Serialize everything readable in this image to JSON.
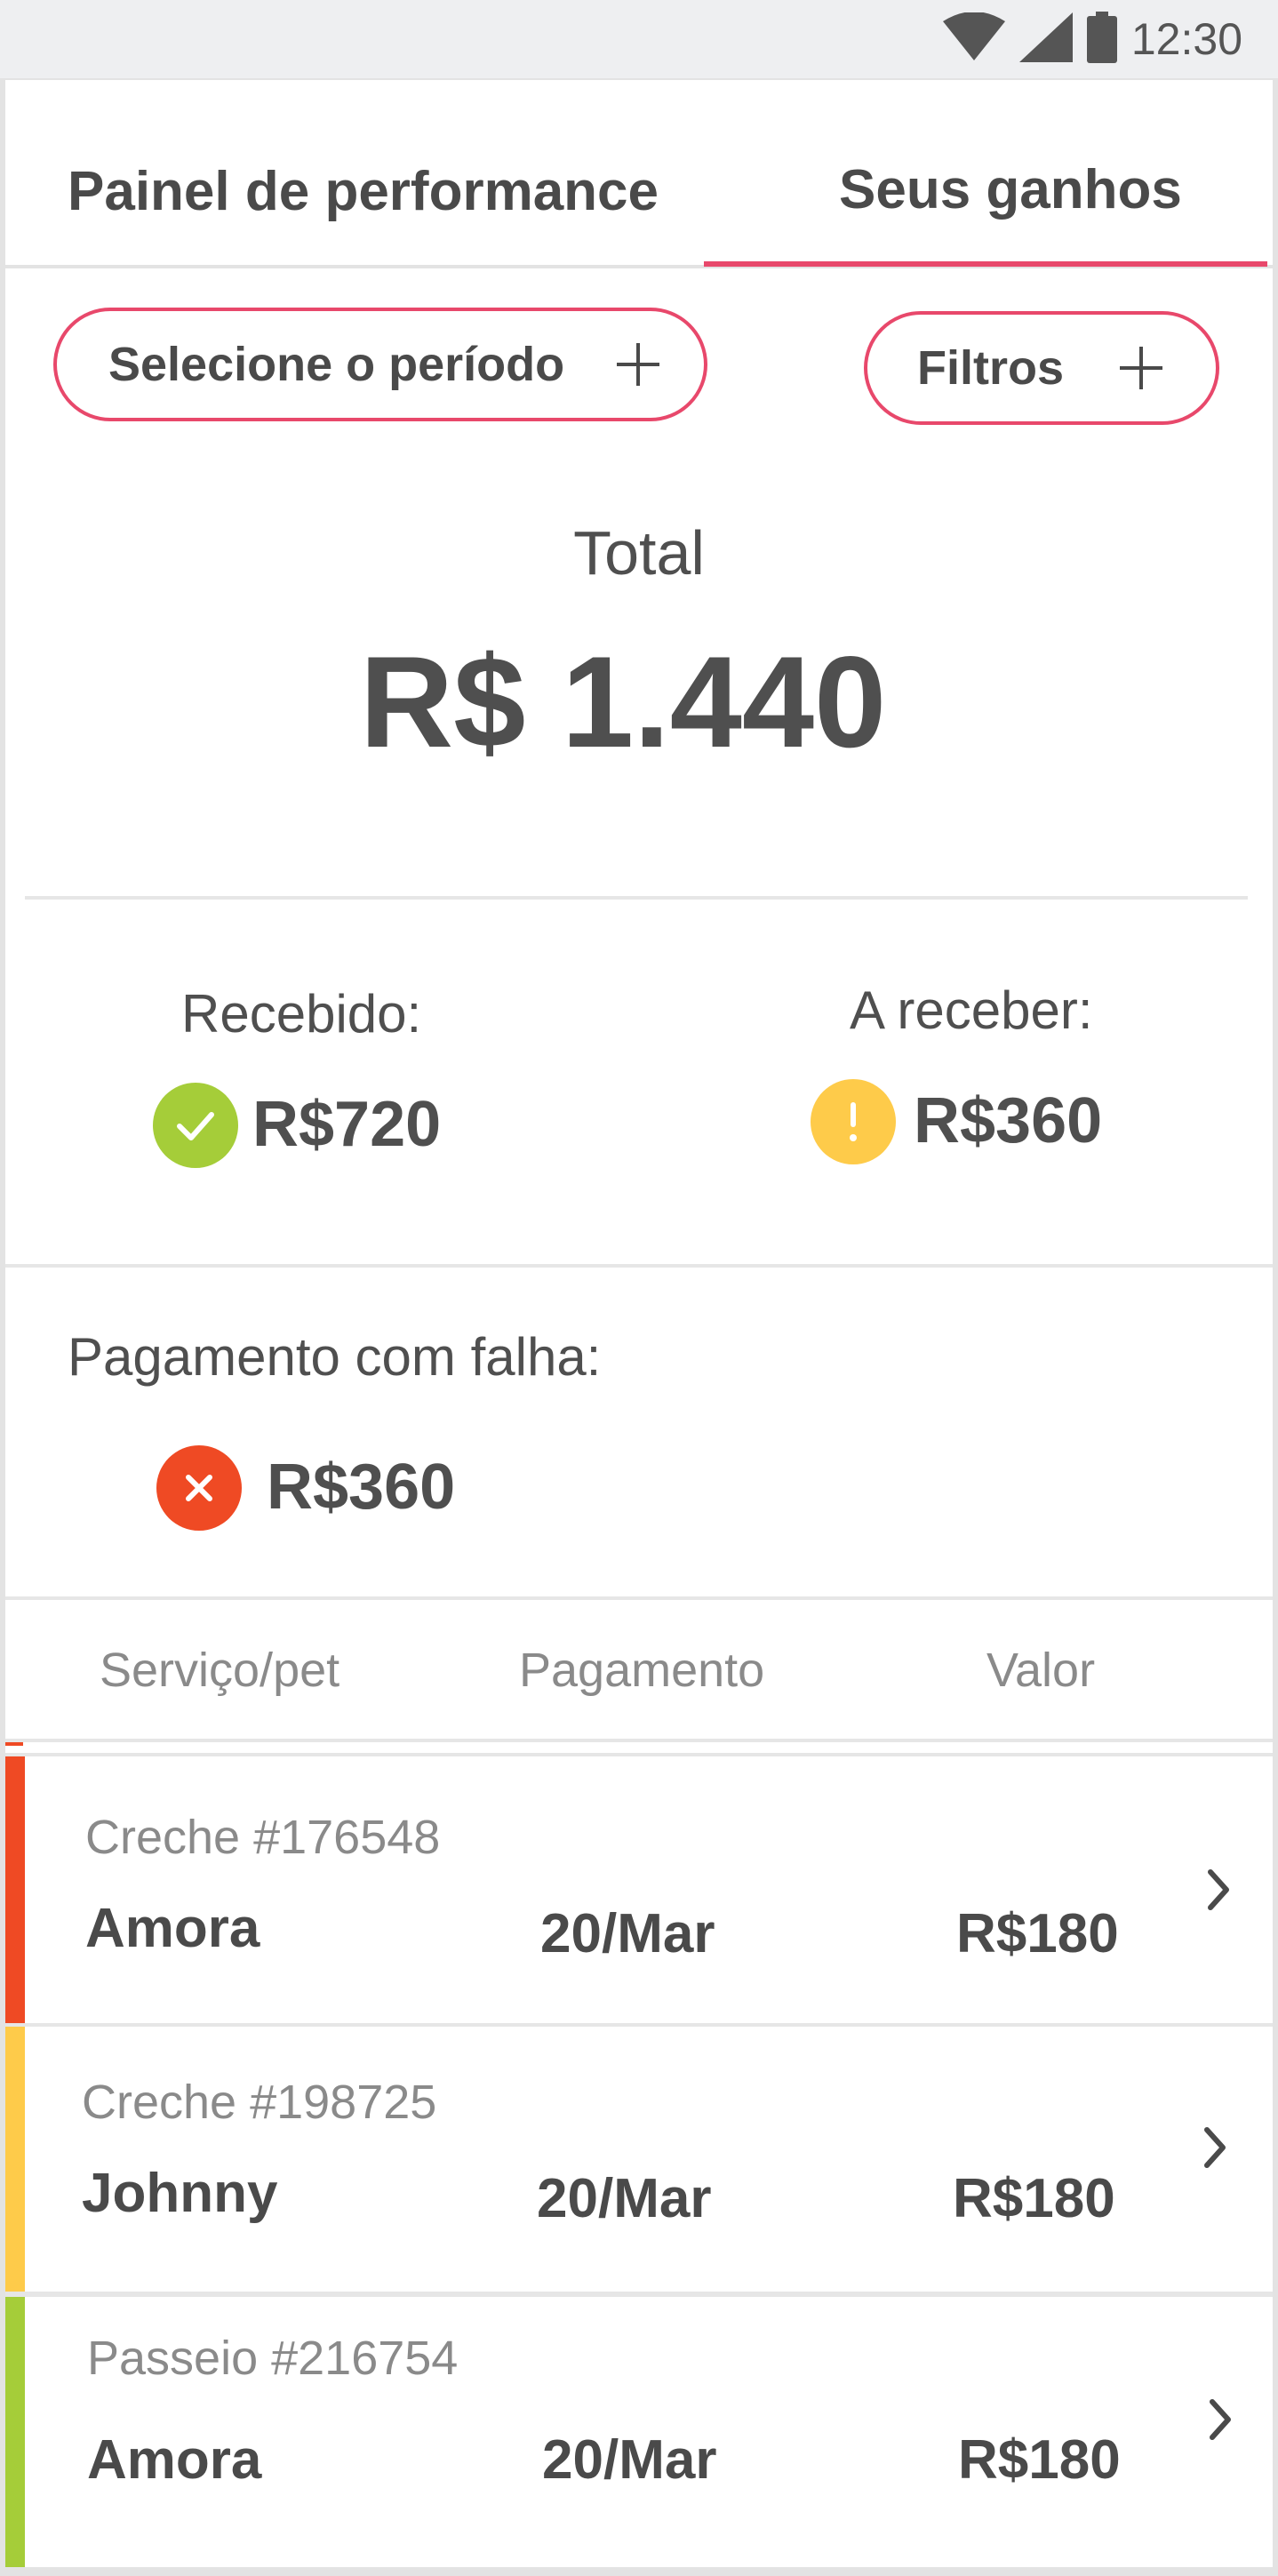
{
  "status_bar": {
    "time": "12:30",
    "icons": [
      "wifi-icon",
      "signal-icon",
      "battery-icon"
    ]
  },
  "tabs": [
    {
      "label": "Painel de performance",
      "active": false
    },
    {
      "label": "Seus ganhos",
      "active": true
    }
  ],
  "filters": {
    "period_label": "Selecione o período",
    "filters_label": "Filtros"
  },
  "total": {
    "label": "Total",
    "value": "R$ 1.440"
  },
  "summary": {
    "received": {
      "label": "Recebido:",
      "value": "R$720",
      "icon": "check-icon"
    },
    "pending": {
      "label": "A receber:",
      "value": "R$360",
      "icon": "exclamation-icon"
    },
    "failed": {
      "label": "Pagamento com falha:",
      "value": "R$360",
      "icon": "close-icon"
    }
  },
  "table": {
    "headers": [
      "Serviço/pet",
      "Pagamento",
      "Valor"
    ],
    "rows": [
      {
        "code": "Creche #176548",
        "pet": "Amora",
        "date": "20/Mar",
        "value": "R$180",
        "status": "failed"
      },
      {
        "code": "Creche #198725",
        "pet": "Johnny",
        "date": "20/Mar",
        "value": "R$180",
        "status": "pending"
      },
      {
        "code": "Passeio #216754",
        "pet": "Amora",
        "date": "20/Mar",
        "value": "R$180",
        "status": "received"
      }
    ]
  },
  "colors": {
    "accent": "#e8486b",
    "received": "#a5cd39",
    "pending": "#fecb4a",
    "failed": "#ef4a24",
    "text": "#4a4a4a",
    "muted": "#8a8a8a"
  }
}
